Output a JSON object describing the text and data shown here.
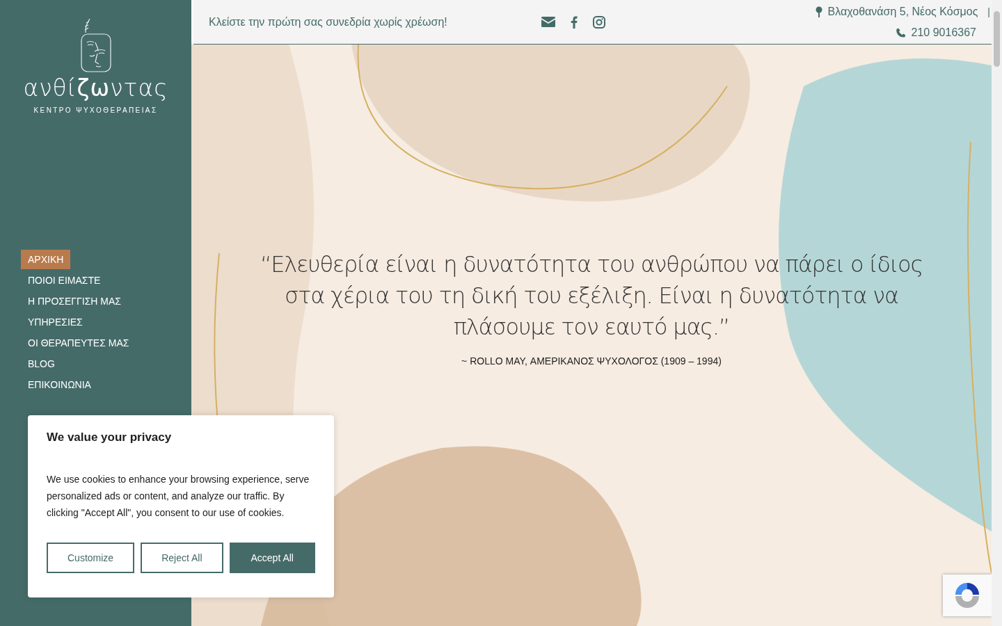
{
  "logo": {
    "wordmark": "ανθί**ζω**ντας",
    "tagline": "ΚΕΝΤΡΟ ΨΥΧΟΘΕΡΑΠΕΙΑΣ"
  },
  "nav": [
    {
      "label": "ΑΡΧΙΚΗ",
      "selected": true
    },
    {
      "label": "ΠΟΙΟΙ ΕΙΜΑΣΤΕ",
      "selected": false
    },
    {
      "label": "Η ΠΡΟΣΕΓΓΙΣΗ ΜΑΣ",
      "selected": false
    },
    {
      "label": "ΥΠΗΡΕΣΙΕΣ",
      "selected": false
    },
    {
      "label": "ΟΙ ΘΕΡΑΠΕΥΤΕΣ ΜΑΣ",
      "selected": false
    },
    {
      "label": "BLOG",
      "selected": false
    },
    {
      "label": "ΕΠΙΚΟΙΝΩΝΙΑ",
      "selected": false
    }
  ],
  "topbar": {
    "promo": "Κλείστε την πρώτη σας συνεδρία χωρίς χρέωση!",
    "address": "Βλαχοθανάση 5, Νέος Κόσμος",
    "separator": "|",
    "phone": "210 9016367"
  },
  "hero": {
    "quote": "“Ελευθερία είναι η δυνατότητα του ανθρώπου να πάρει ο ίδιος στα χέρια του τη δική του εξέλιξη. Είναι η δυνατότητα να πλάσουμε τον εαυτό μας.”",
    "author": "~ ROLLO MAY, ΑΜΕΡΙΚΑΝΟΣ ΨΥΧΟΛΟΓΟΣ (1909 – 1994)"
  },
  "cookie_banner": {
    "title": "We value your privacy",
    "text": "We use cookies to enhance your browsing experience, serve personalized ads or content, and analyze our traffic. By clicking \"Accept All\", you consent to our use of cookies.",
    "buttons": [
      {
        "label": "Customize",
        "kind": "outline"
      },
      {
        "label": "Reject All",
        "kind": "outline"
      },
      {
        "label": "Accept All",
        "kind": "filled"
      }
    ]
  }
}
